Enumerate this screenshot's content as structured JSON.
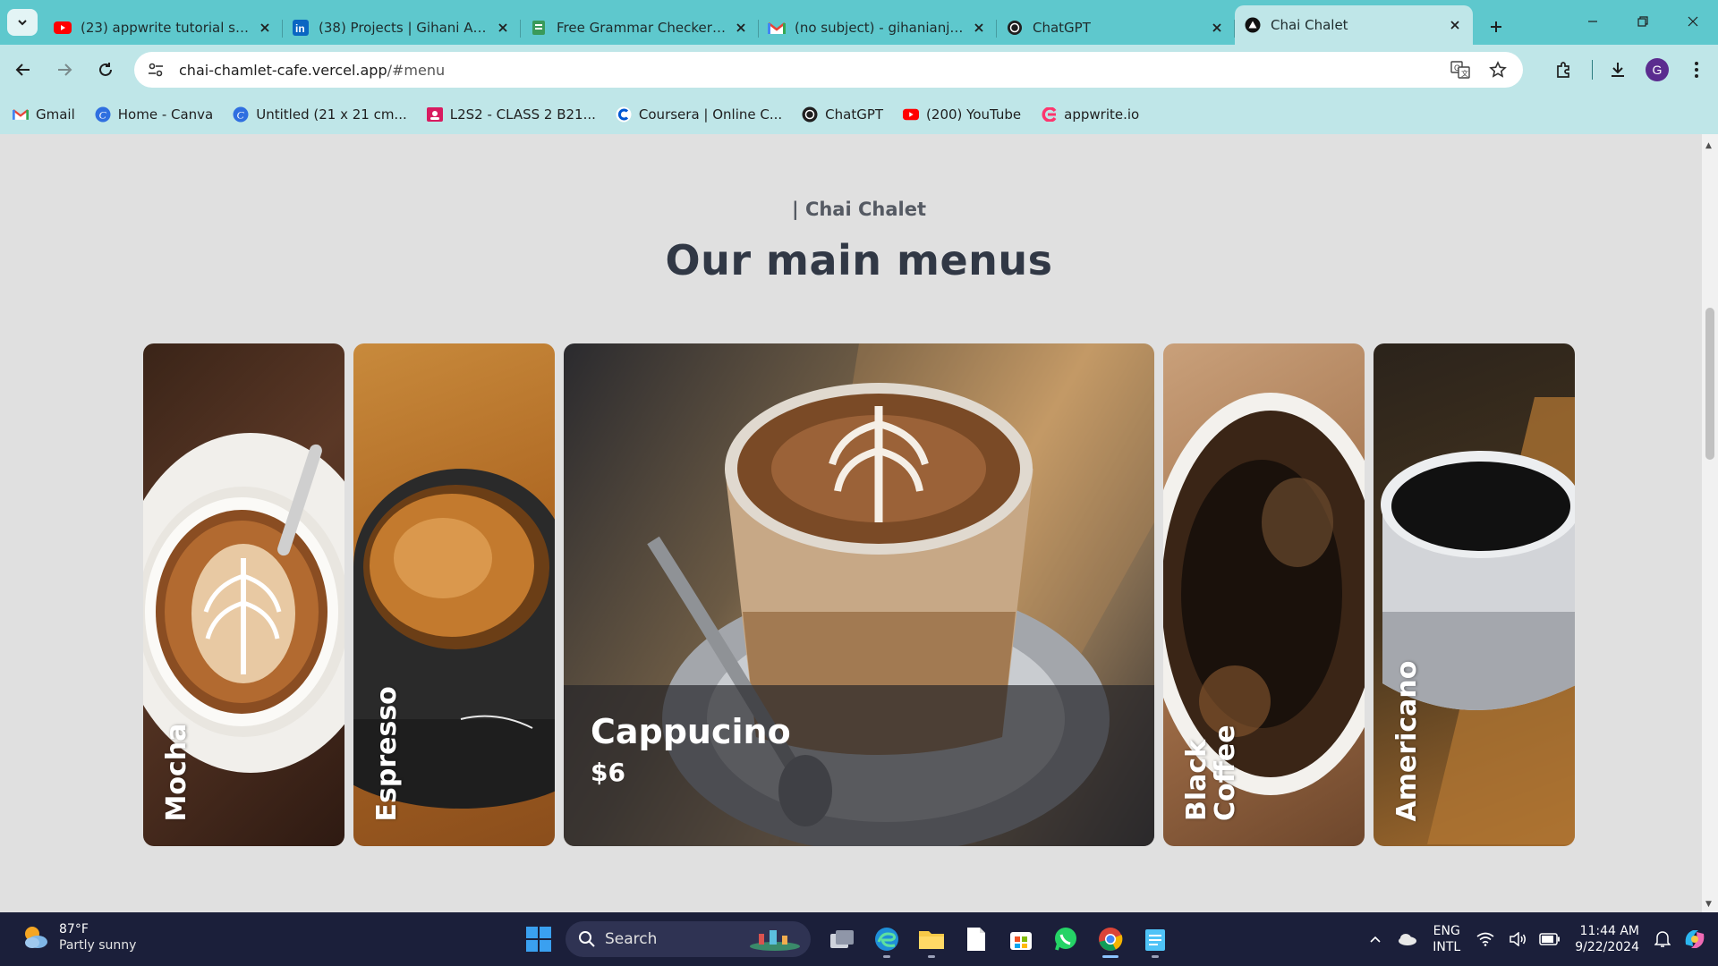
{
  "browser": {
    "tabs": [
      {
        "title": "(23) appwrite tutorial sinha",
        "icon": "youtube-icon"
      },
      {
        "title": "(38) Projects | Gihani Anjali",
        "icon": "linkedin-icon"
      },
      {
        "title": "Free Grammar Checker (no",
        "icon": "grammar-icon"
      },
      {
        "title": "(no subject) - gihanianjalik",
        "icon": "gmail-icon"
      },
      {
        "title": "ChatGPT",
        "icon": "chatgpt-icon"
      },
      {
        "title": "Chai Chalet",
        "icon": "vercel-icon"
      }
    ],
    "url_host": "chai-chamlet-cafe.vercel.app",
    "url_path": "/#menu",
    "profile_initial": "G",
    "bookmarks": [
      {
        "label": "Gmail",
        "icon": "gmail-icon"
      },
      {
        "label": "Home - Canva",
        "icon": "canva-icon"
      },
      {
        "label": "Untitled (21 x 21 cm...",
        "icon": "canva-icon"
      },
      {
        "label": "L2S2 - CLASS 2 B21...",
        "icon": "classroom-icon"
      },
      {
        "label": "Coursera | Online C...",
        "icon": "coursera-icon"
      },
      {
        "label": "ChatGPT",
        "icon": "chatgpt-icon"
      },
      {
        "label": "(200) YouTube",
        "icon": "youtube-icon"
      },
      {
        "label": "appwrite.io",
        "icon": "appwrite-icon"
      }
    ]
  },
  "page": {
    "eyebrow": "| Chai Chalet",
    "heading": "Our main menus",
    "menu": [
      {
        "name": "Mocha"
      },
      {
        "name": "Espresso"
      },
      {
        "name": "Cappucino",
        "price": "$6"
      },
      {
        "name": "Black Coffee"
      },
      {
        "name": "Americano"
      }
    ]
  },
  "taskbar": {
    "temperature": "87°F",
    "condition": "Partly sunny",
    "search_label": "Search",
    "lang_line1": "ENG",
    "lang_line2": "INTL",
    "time": "11:44 AM",
    "date": "9/22/2024"
  },
  "colors": {
    "tab_strip": "#5ec8cd",
    "toolbar": "#bfe6e8",
    "page_bg": "#e0e0e0",
    "heading": "#313845",
    "taskbar": "#1b1f3a"
  }
}
